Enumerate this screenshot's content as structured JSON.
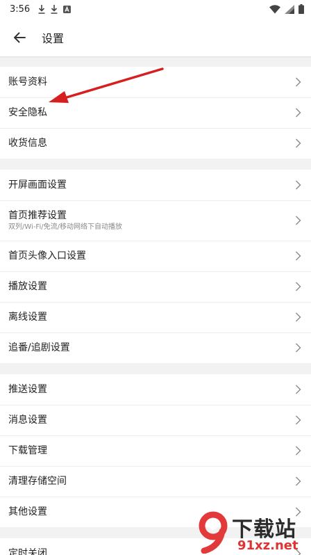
{
  "status_bar": {
    "time": "3:56"
  },
  "header": {
    "title": "设置"
  },
  "groups": [
    {
      "items": [
        {
          "label": "账号资料"
        },
        {
          "label": "安全隐私"
        },
        {
          "label": "收货信息"
        }
      ]
    },
    {
      "items": [
        {
          "label": "开屏画面设置"
        },
        {
          "label": "首页推荐设置",
          "sub": "双列/Wi-Fi/免流/移动网络下自动播放"
        },
        {
          "label": "首页头像入口设置"
        },
        {
          "label": "播放设置"
        },
        {
          "label": "离线设置"
        },
        {
          "label": "追番/追剧设置"
        }
      ]
    },
    {
      "items": [
        {
          "label": "推送设置"
        },
        {
          "label": "消息设置"
        },
        {
          "label": "下载管理"
        },
        {
          "label": "清理存储空间"
        },
        {
          "label": "其他设置"
        }
      ]
    },
    {
      "items": [
        {
          "label": "定时关闭"
        }
      ]
    }
  ],
  "watermark": {
    "brand": "下载站",
    "url": "91xz.net"
  },
  "colors": {
    "annotation_arrow": "#d61f1f",
    "divider": "#ececec",
    "background": "#f2f2f2"
  }
}
